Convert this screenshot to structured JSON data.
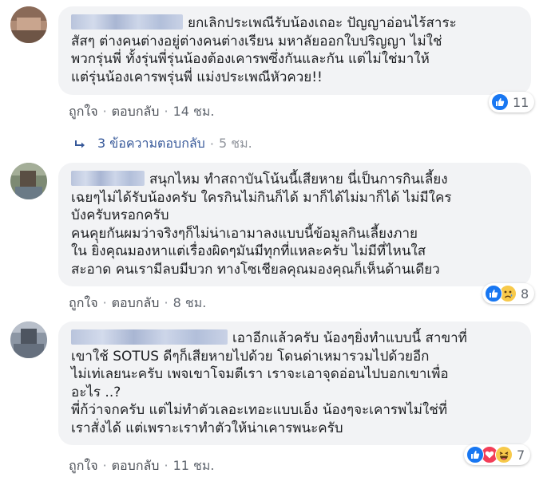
{
  "comments": [
    {
      "lines": [
        "ยกเลิกประเพณีรับน้องเถอะ ปัญญาอ่อนไร้สาระ",
        "สัสๆ ต่างคนต่างอยู่ต่างคนต่างเรียน มหาลัยออกใบปริญญา ไม่ใช่",
        "พวกรุ่นพี่ ทั้งรุ่นพี่รุ่นน้องต้องเคารพซึ่งกันและกัน แต่ไม่ใช่มาให้",
        "แต่รุ่นน้องเคารพรุ่นพี่ แม่งประเพณีหัวควย!!"
      ],
      "like_label": "ถูกใจ",
      "reply_label": "ตอบกลับ",
      "time": "14 ชม.",
      "reaction_count": "11",
      "reaction_icons": [
        "like-icon"
      ],
      "replies_summary": {
        "text": "3 ข้อความตอบกลับ",
        "time": "5 ชม."
      }
    },
    {
      "lines": [
        "สนุกไหม ทำสถาบันโน้นนี้เสียหาย นี่เป็นการกินเลี้ยง",
        "เฉยๆไม่ได้รับน้องครับ ใครกินไม่กินก็ได้ มาก็ได้ไม่มาก็ได้ ไม่มีใคร",
        "บังครับหรอกครับ",
        "คนคุยกันผมว่าจริงๆก็ไม่น่าเอามาลงแบบนี้ข้อมูลกินเลี้ยงภาย",
        "ใน ยิ่งคุณมองหาแต่เรื่องผิดๆมันมีทุกที่แหละครับ ไม่มีที่ไหนใส",
        "สะอาด คนเรามีลบมีบวก ทางโซเชียลคุณมองคุณก็เห็นด้านเดียว"
      ],
      "like_label": "ถูกใจ",
      "reply_label": "ตอบกลับ",
      "time": "8 ชม.",
      "reaction_count": "8",
      "reaction_icons": [
        "like-icon",
        "sad-icon"
      ]
    },
    {
      "lines": [
        "เอาอีกแล้วครับ น้องๆยิ่งทำแบบนี้ สาขาที่",
        "เขาใช้ SOTUS ดีๆก็เสียหายไปด้วย โดนด่าเหมารวมไปด้วยอีก",
        "ไม่เท่เลยนะครับ เพจเขาโจมตีเรา เราจะเอาจุดอ่อนไปบอกเขาเพื่อ",
        "อะไร ..?",
        "พี่ก้ว่าจกครับ แต่ไม่ทำตัวเลอะเทอะแบบเอ็ง น้องๆจะเคารพไม่ใช่ที่",
        "เราสั่งได้ แต่เพราะเราทำตัวให้น่าเคารพนะครับ"
      ],
      "like_label": "ถูกใจ",
      "reply_label": "ตอบกลับ",
      "time": "11 ชม.",
      "reaction_count": "7",
      "reaction_icons": [
        "like-icon",
        "love-icon",
        "haha-icon"
      ]
    }
  ],
  "colors": {
    "bubble": "#f2f3f5",
    "link": "#365899",
    "meta": "#616770",
    "like": "#1877f2",
    "love": "#f33e58",
    "emoji": "#f7c94a"
  }
}
